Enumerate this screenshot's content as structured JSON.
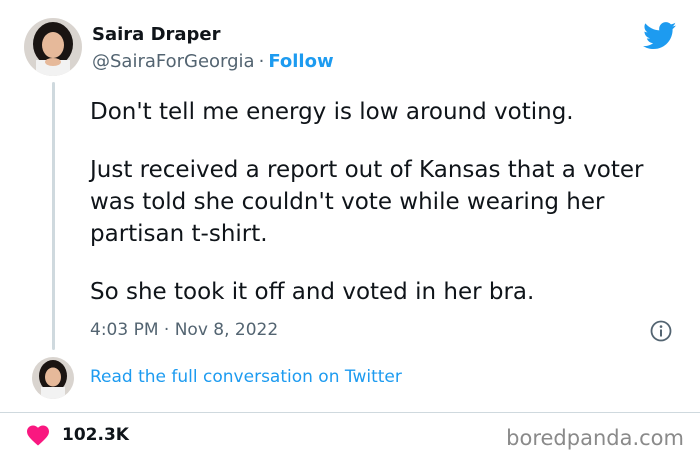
{
  "author": {
    "name": "Saira Draper",
    "handle": "@SairaForGeorgia",
    "separator": "·",
    "follow_label": "Follow"
  },
  "tweet": {
    "paragraphs": [
      "Don't tell me energy is low around voting.",
      "Just received a report out of Kansas that a voter was told she couldn't vote while wearing her partisan t-shirt.",
      "So she took it off and voted in her bra."
    ],
    "timestamp": "4:03 PM · Nov 8, 2022"
  },
  "read_full_label": "Read the full conversation on Twitter",
  "likes_count": "102.3K",
  "watermark": "boredpanda.com",
  "icons": {
    "logo": "twitter-bird-icon",
    "info": "info-icon",
    "like": "heart-icon"
  },
  "colors": {
    "accent": "#1d9bf0",
    "text": "#0f1419",
    "muted": "#536471",
    "heart": "#f91880"
  }
}
